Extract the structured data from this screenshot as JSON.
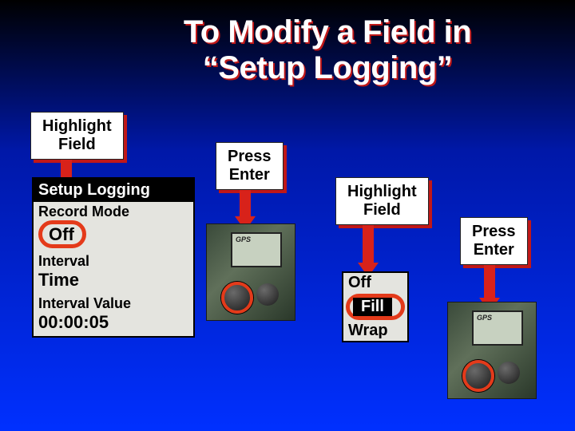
{
  "title": {
    "line1": "To Modify a Field in",
    "line2": "“Setup Logging”"
  },
  "labels": {
    "highlight1": "Highlight\nField",
    "press1": "Press\nEnter",
    "highlight2": "Highlight\nField",
    "press2": "Press\nEnter"
  },
  "setup_screen": {
    "header": "Setup Logging",
    "record_mode_label": "Record Mode",
    "record_mode_value": "Off",
    "interval_label": "Interval",
    "interval_value": "Time",
    "interval_value_label": "Interval Value",
    "interval_time_value": "00:00:05"
  },
  "popup": {
    "items": [
      "Off",
      "Fill",
      "Wrap"
    ],
    "highlighted": "Fill"
  },
  "device": {
    "brand": "GPS"
  }
}
